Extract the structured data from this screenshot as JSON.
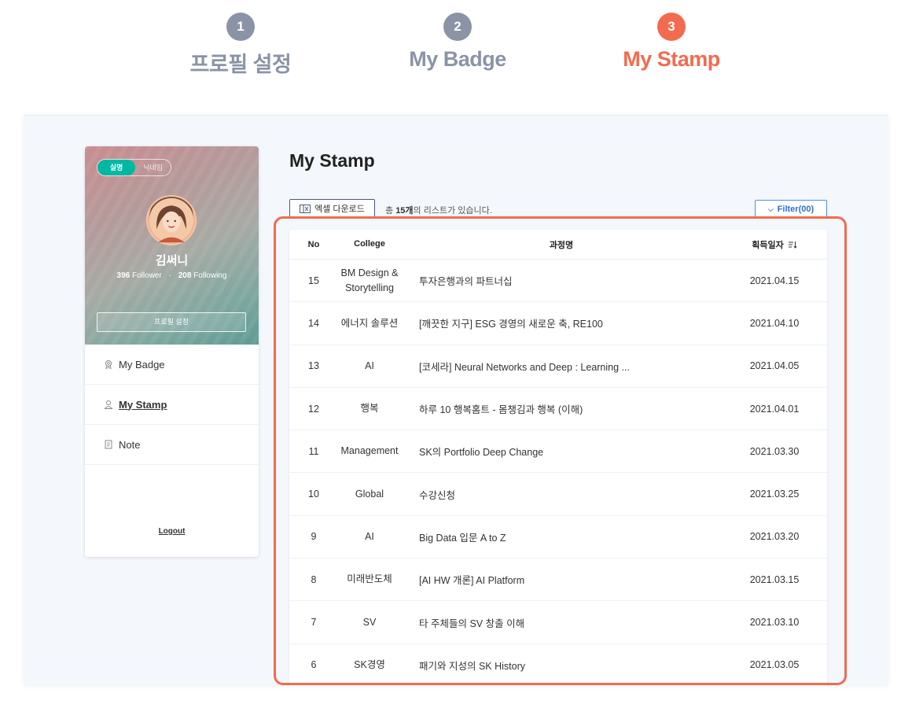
{
  "steps": [
    {
      "number": "1",
      "label": "프로필 설정"
    },
    {
      "number": "2",
      "label": "My Badge"
    },
    {
      "number": "3",
      "label": "My Stamp"
    }
  ],
  "colors": {
    "accent": "#f26b4f",
    "step_inactive": "#8a94a6",
    "toggle_on": "#00b8a3",
    "filter_blue": "#2f6fd6"
  },
  "profile": {
    "toggle_on": "실명",
    "toggle_off": "닉네임",
    "name": "김써니",
    "followers": "396",
    "followers_label": "Follower",
    "following": "208",
    "following_label": "Following",
    "settings_button": "프로필 설정"
  },
  "menu": [
    {
      "label": "My Badge",
      "icon": "badge-icon"
    },
    {
      "label": "My Stamp",
      "icon": "person-icon"
    },
    {
      "label": "Note",
      "icon": "note-icon"
    }
  ],
  "logout": "Logout",
  "content": {
    "title": "My Stamp",
    "excel_button": "엑셀 다운로드",
    "count_prefix": "총 ",
    "count_value": "15개",
    "count_suffix": "의 리스트가 있습니다.",
    "filter_button": "Filter(00)"
  },
  "table": {
    "headers": {
      "no": "No",
      "college": "College",
      "course": "과정명",
      "date": "획득일자"
    },
    "rows": [
      {
        "no": "15",
        "college": "BM Design & Storytelling",
        "course": "투자은행과의 파트너십",
        "date": "2021.04.15"
      },
      {
        "no": "14",
        "college": "에너지 솔루션",
        "course": "[깨끗한 지구] ESG 경영의 새로운 축, RE100",
        "date": "2021.04.10"
      },
      {
        "no": "13",
        "college": "AI",
        "course": "[코세라] Neural Networks and Deep : Learning ...",
        "date": "2021.04.05"
      },
      {
        "no": "12",
        "college": "행복",
        "course": "하루 10 행복홈트 - 몸챙김과 행복 (이해)",
        "date": "2021.04.01"
      },
      {
        "no": "11",
        "college": "Management",
        "course": "SK의 Portfolio Deep Change",
        "date": "2021.03.30"
      },
      {
        "no": "10",
        "college": "Global",
        "course": "수강신청",
        "date": "2021.03.25"
      },
      {
        "no": "9",
        "college": "AI",
        "course": "Big Data 입문 A to Z",
        "date": "2021.03.20"
      },
      {
        "no": "8",
        "college": "미래반도체",
        "course": "[AI HW 개론] AI Platform",
        "date": "2021.03.15"
      },
      {
        "no": "7",
        "college": "SV",
        "course": "타 주체들의 SV 창출 이해",
        "date": "2021.03.10"
      },
      {
        "no": "6",
        "college": "SK경영",
        "course": "패기와 지성의 SK History",
        "date": "2021.03.05"
      }
    ]
  }
}
